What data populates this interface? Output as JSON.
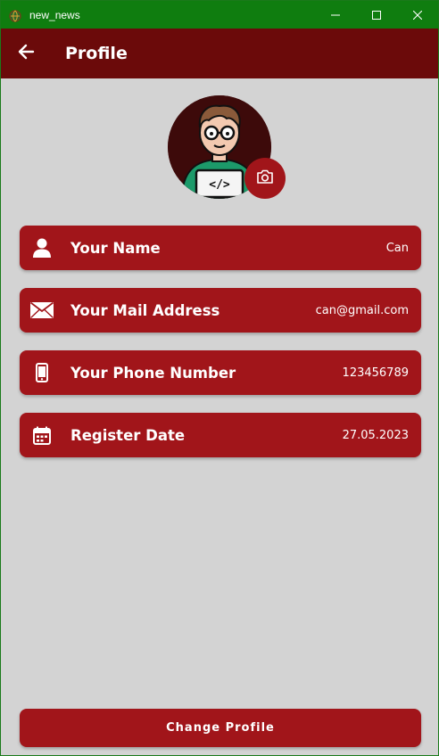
{
  "window": {
    "title": "new_news",
    "icon": "globe-icon",
    "controls": [
      "minimize-icon",
      "maximize-icon",
      "close-icon"
    ]
  },
  "appbar": {
    "title": "Profile",
    "back_icon": "arrow-left-icon"
  },
  "avatar": {
    "image": "developer-avatar",
    "camera_icon": "camera-icon"
  },
  "info_cards": [
    {
      "icon": "person-icon",
      "label": "Your Name",
      "value": "Can"
    },
    {
      "icon": "mail-icon",
      "label": "Your Mail Address",
      "value": "can@gmail.com"
    },
    {
      "icon": "phone-icon",
      "label": "Your Phone Number",
      "value": "123456789"
    },
    {
      "icon": "calendar-icon",
      "label": "Register Date",
      "value": "27.05.2023"
    }
  ],
  "actions": {
    "change_profile_label": "Change Profile"
  },
  "colors": {
    "titlebar": "#0f7d0f",
    "appbar": "#6b0a0a",
    "card": "#a1151a",
    "background": "#d3d3d3"
  }
}
